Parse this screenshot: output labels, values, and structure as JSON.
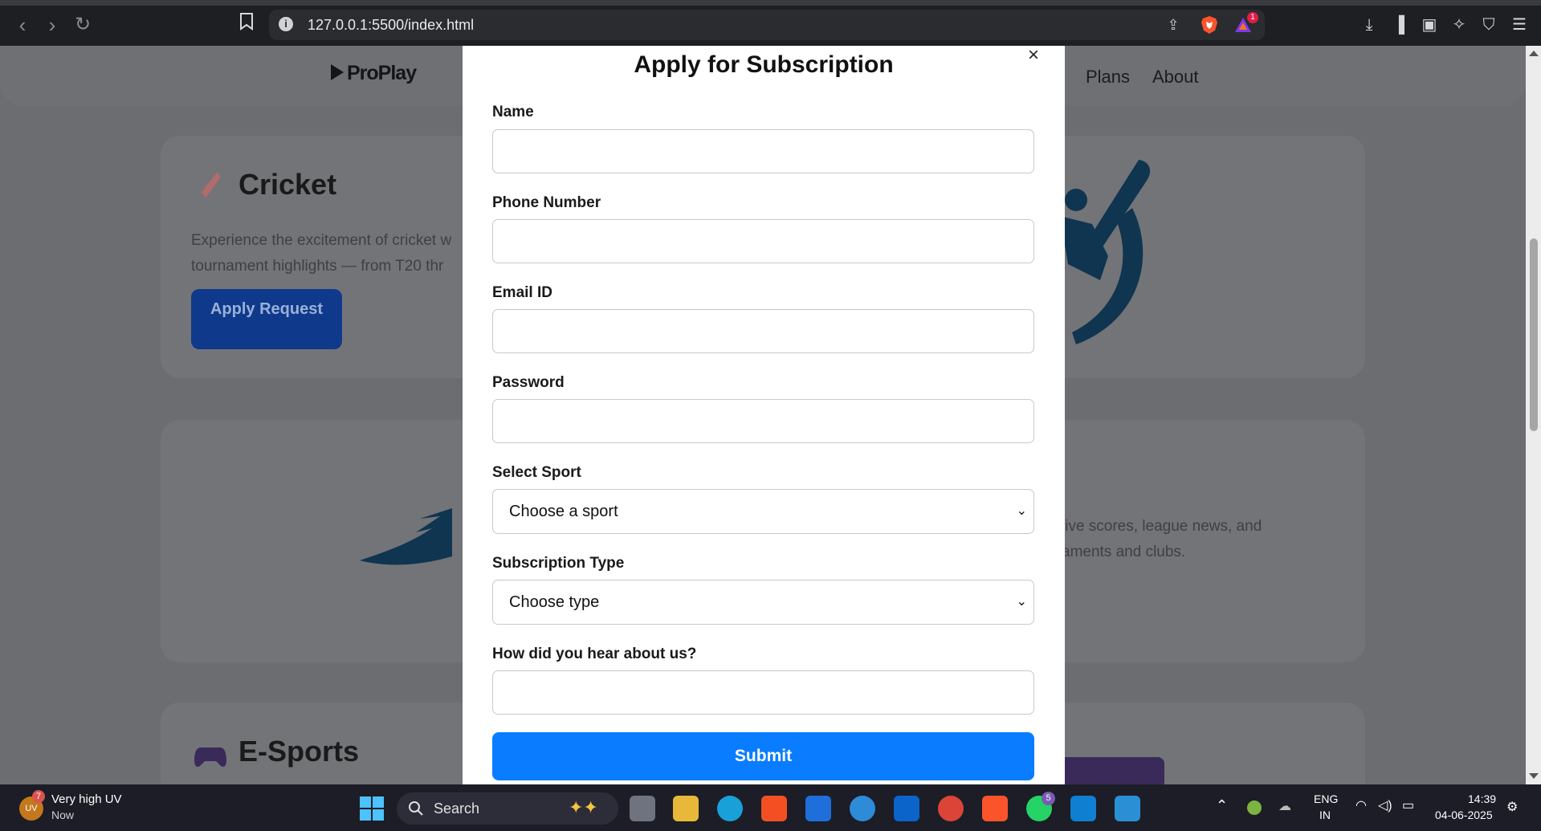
{
  "browser": {
    "url": "127.0.0.1:5500/index.html",
    "tab_badge": "1"
  },
  "page": {
    "logo": "ProPlay",
    "nav": [
      "Plans",
      "About"
    ],
    "cricket": {
      "title": "Cricket",
      "text_line1": "Experience the excitement of cricket w",
      "text_line2": "tournament highlights — from T20 thr",
      "button": "Apply Request"
    },
    "football": {
      "text_line1": "live scores, league news, and",
      "text_line2": "aments and clubs."
    },
    "esports": {
      "title": "E-Sports"
    }
  },
  "modal": {
    "close": "×",
    "title": "Apply for Subscription",
    "fields": {
      "name_label": "Name",
      "phone_label": "Phone Number",
      "email_label": "Email ID",
      "password_label": "Password",
      "sport_label": "Select Sport",
      "sport_value": "Choose a sport",
      "type_label": "Subscription Type",
      "type_value": "Choose type",
      "hear_label": "How did you hear about us?"
    },
    "submit": "Submit"
  },
  "taskbar": {
    "weather_title": "Very high UV",
    "weather_sub": "Now",
    "weather_badge": "7",
    "uv_label": "UV",
    "search": "Search",
    "whatsapp_badge": "5",
    "lang1": "ENG",
    "lang2": "IN",
    "time": "14:39",
    "date": "04-06-2025"
  },
  "colors": {
    "submit": "#0a7cff",
    "apply_button": "#0f3a8c"
  }
}
